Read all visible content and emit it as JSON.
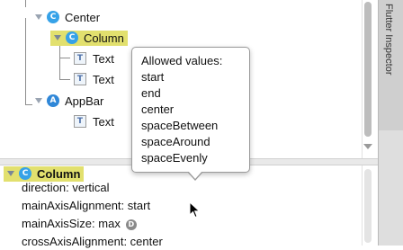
{
  "tree": {
    "nodes": [
      {
        "label": "Center",
        "badge": "C"
      },
      {
        "label": "Column",
        "badge": "C"
      },
      {
        "label": "Text",
        "badge": "T"
      },
      {
        "label": "Text",
        "badge": "T"
      },
      {
        "label": "AppBar",
        "badge": "A"
      },
      {
        "label": "Text",
        "badge": "T"
      }
    ]
  },
  "props": {
    "header": {
      "label": "Column",
      "badge": "C"
    },
    "lines": [
      {
        "name": "direction",
        "value": "vertical"
      },
      {
        "name": "mainAxisAlignment",
        "value": "start"
      },
      {
        "name": "mainAxisSize",
        "value": "max",
        "badge": "D"
      },
      {
        "name": "crossAxisAlignment",
        "value": "center"
      }
    ]
  },
  "tooltip": {
    "title": "Allowed values:",
    "values": [
      "start",
      "end",
      "center",
      "spaceBetween",
      "spaceAround",
      "spaceEvenly"
    ]
  },
  "side_tab": {
    "label": "Flutter Inspector"
  },
  "colors": {
    "highlight": "#e2e06e",
    "badge_blue": "#36a2e8"
  },
  "icons": [
    "expand-triangle-icon",
    "widget-badge-icon",
    "text-widget-icon",
    "mouse-pointer-icon"
  ]
}
